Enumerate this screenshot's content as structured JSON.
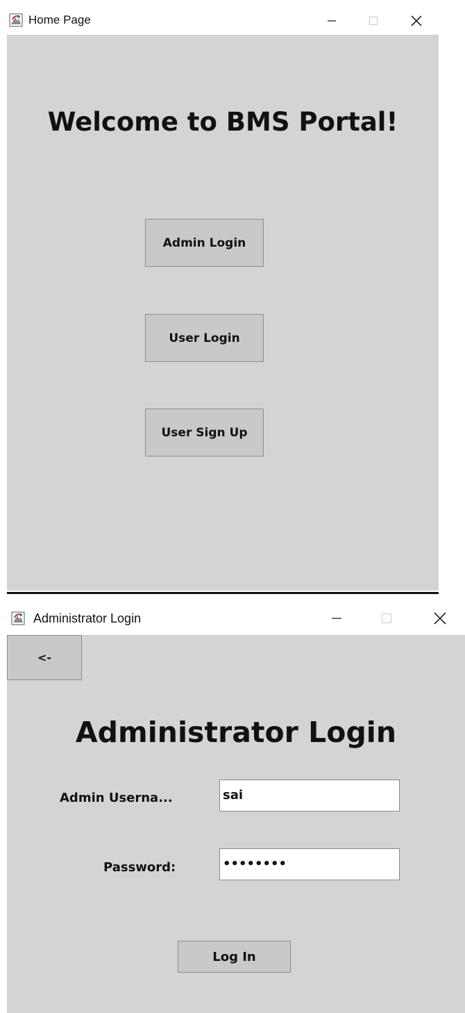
{
  "home_window": {
    "title": "Home Page",
    "heading": "Welcome to BMS Portal!",
    "buttons": {
      "admin_login": "Admin Login",
      "user_login": "User Login",
      "user_signup": "User Sign Up"
    }
  },
  "admin_window": {
    "title": "Administrator Login",
    "back_label": "<-",
    "heading": "Administrator Login",
    "username_label": "Admin Userna...",
    "username_value": "sai",
    "password_label": "Password:",
    "password_value": "••••••••",
    "login_label": "Log In"
  },
  "window_controls": {
    "minimize": "minimize-icon",
    "maximize": "maximize-icon",
    "close": "close-icon"
  },
  "colors": {
    "content_background": "#d4d4d4",
    "button_background": "#c9c9c9",
    "titlebar_background": "#ffffff"
  }
}
